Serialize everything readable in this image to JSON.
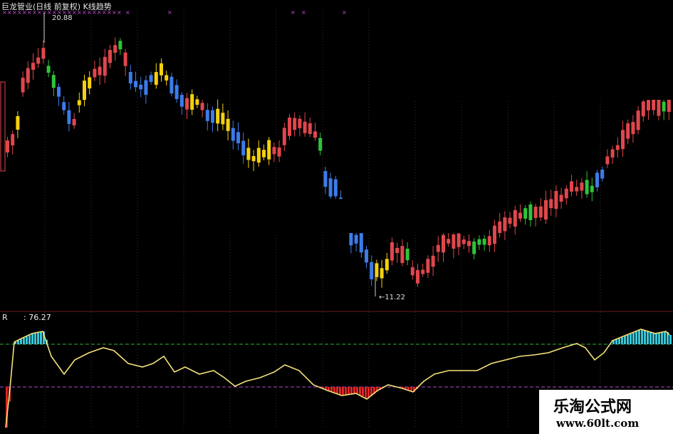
{
  "header": {
    "title": "巨龙管业(日线 前复权) K线趋势",
    "high_label": "20.88",
    "low_label": "←11.22"
  },
  "indicator": {
    "name": "R",
    "value": ": 76.27"
  },
  "watermark": {
    "line1": "乐淘公式网",
    "line2": "www.60lt.com"
  },
  "colors": {
    "up": "#e0474c",
    "down": "#3d7be8",
    "yellow": "#f5d10d",
    "green": "#2fc43a",
    "r_line": "#f5e27a",
    "upper_band": "#2fb53a",
    "lower_band": "#b04cd1",
    "above_fill": "#38c7d8",
    "below_fill": "#e02525"
  },
  "chart_data": {
    "type": "candlestick",
    "price_high": 20.88,
    "price_low": 11.22,
    "indicator_last": 76.27
  }
}
